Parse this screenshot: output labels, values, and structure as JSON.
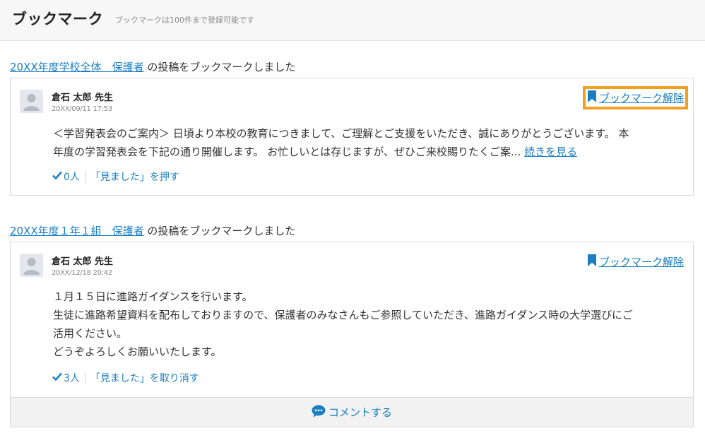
{
  "header": {
    "title": "ブックマーク",
    "subtitle": "ブックマークは100件まで登録可能です"
  },
  "icons": {
    "bookmark": "bookmark-icon",
    "check": "check-icon",
    "comment": "comment-bubble-icon",
    "avatar": "user-avatar-icon"
  },
  "colors": {
    "link": "#1a7fc1",
    "highlight": "#f0a020"
  },
  "posts": [
    {
      "group_link": "20XX年度学校全体　保護者",
      "heading_suffix": "の投稿をブックマークしました",
      "author": "倉石 太郎 先生",
      "time": "20XX/09/11 17:53",
      "bookmark_label": "ブックマーク解除",
      "body_lines": [
        "＜学習発表会のご案内＞ 日頃より本校の教育につきまして、ご理解とご支援をいただき、誠にありがとうございます。 本",
        "年度の学習発表会を下記の通り開催します。 お忙しいとは存じますが、ぜひご来校賜りたくご案..."
      ],
      "read_more": "続きを見る",
      "seen_count": "0人",
      "seen_action": "「見ました」を押す"
    },
    {
      "group_link": "20XX年度１年１組　保護者",
      "heading_suffix": "の投稿をブックマークしました",
      "author": "倉石 太郎 先生",
      "time": "20XX/12/18 20:42",
      "bookmark_label": "ブックマーク解除",
      "body_lines": [
        "１月１５日に進路ガイダンスを行います。",
        "生徒に進路希望資料を配布しておりますので、保護者のみなさんもご参照していただき、進路ガイダンス時の大学選びにご",
        "活用ください。",
        "どうぞよろしくお願いいたします。"
      ],
      "seen_count": "3人",
      "seen_action": "「見ました」を取り消す",
      "comment_label": "コメントする"
    }
  ]
}
